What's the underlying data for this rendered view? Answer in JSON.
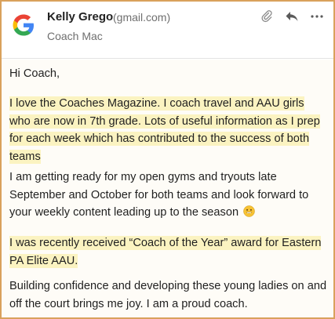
{
  "header": {
    "sender_name": "Kelly Grego",
    "sender_email": "(gmail.com)",
    "recipient": "Coach Mac",
    "avatar_icon": "google-g-icon",
    "actions": [
      "paperclip-icon",
      "reply-icon",
      "more-icon"
    ]
  },
  "message": {
    "greeting": "Hi Coach,",
    "p1": "I love the Coaches Magazine. I coach travel and AAU girls who are now in 7th grade. Lots of useful information as I prep for each week which has contributed to the success of both teams",
    "p2": "I am getting ready for my open gyms and tryouts late September and October for both teams and look forward to your weekly content leading up to the season",
    "p2_emoji": "smiling-face-emoji",
    "p3": "I was recently received “Coach of the Year” award for Eastern PA Elite AAU.",
    "p4": "Building confidence and developing these young ladies on and off the court brings me joy. I am a proud coach."
  },
  "colors": {
    "highlight": "#fbf3c1",
    "border": "#d9a15c",
    "text": "#1f1f1f",
    "muted": "#6f6f6f"
  }
}
